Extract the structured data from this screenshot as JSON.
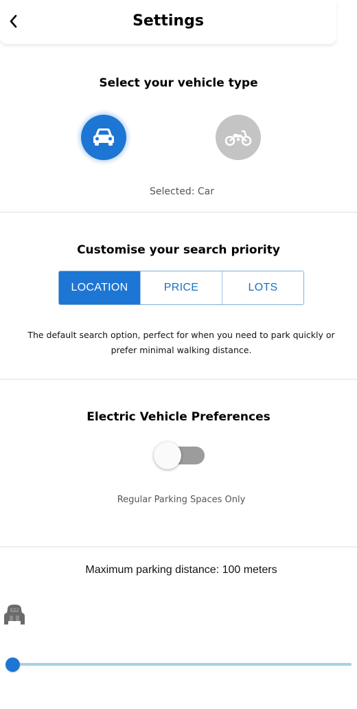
{
  "header": {
    "title": "Settings",
    "back_icon": "chevron-left-icon"
  },
  "vehicle": {
    "title": "Select your vehicle type",
    "options": [
      {
        "name": "Car",
        "icon": "car-icon",
        "selected": true
      },
      {
        "name": "Motorcycle",
        "icon": "motorcycle-icon",
        "selected": false
      }
    ],
    "selected_text": "Selected: Car",
    "active_color": "#1d76d3",
    "inactive_color": "#c4c4c4"
  },
  "priority": {
    "title": "Customise your search priority",
    "options": [
      "LOCATION",
      "PRICE",
      "LOTS"
    ],
    "active_index": 0,
    "description": "The default search option, perfect for when you need to park quickly or prefer minimal walking distance."
  },
  "ev": {
    "title": "Electric Vehicle Preferences",
    "toggle_on": false,
    "status_text": "Regular Parking Spaces Only"
  },
  "distance": {
    "label": "Maximum parking distance: 100 meters",
    "icon": "walking-icon",
    "slider_value_fraction": 0.0
  }
}
